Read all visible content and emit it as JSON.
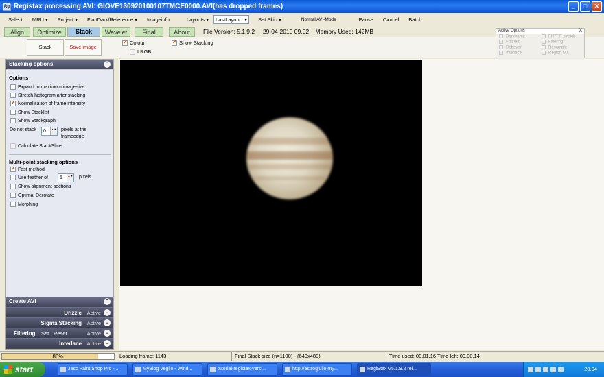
{
  "window": {
    "title": "Registax processing AVI: GIOVE130920100107TMCE0000.AVI(has dropped frames)",
    "icon": "registax-app-icon"
  },
  "menu": {
    "items": [
      "Select",
      "MRU ▾",
      "Project ▾",
      "Flat/Dark/Reference ▾",
      "Imageinfo",
      "Layouts ▾"
    ],
    "layout_value": "LastLayout",
    "items2": [
      "Set Skin ▾"
    ],
    "mode": "Normal AVI-Mode",
    "actions": [
      "Pause",
      "Cancel",
      "Batch"
    ]
  },
  "tabs": [
    "Align",
    "Optimize",
    "Stack",
    "Wavelet",
    "Final",
    "About"
  ],
  "active_tab": "Stack",
  "fileinfo": {
    "version": "File Version: 5.1.9.2",
    "date": "29-04-2010 09.02",
    "memory": "Memory Used: 142MB"
  },
  "toolbar": {
    "stack_label": "Stack",
    "save_label": "Save image",
    "colour": "Colour",
    "lrgb": "LRGB",
    "show_stacking": "Show Stacking"
  },
  "active_options": {
    "title": "Active Options",
    "close": "X",
    "left": [
      "Darkframe",
      "Flatfield",
      "Debayer",
      "Interlace"
    ],
    "right": [
      "FIT/TIF stretch",
      "Filtering",
      "Resample",
      "Region.O.I."
    ]
  },
  "stacking": {
    "header": "Stacking options",
    "options_title": "Options",
    "expand": "Expand to maximum imagesize",
    "stretch": "Stretch histogram after stacking",
    "normalisation": "Normalisation of frame intensity",
    "show_stacklist": "Show Stacklist",
    "show_stackgraph": "Show Stackgraph",
    "do_not_stack": "Do not stack",
    "do_not_stack_value": "0",
    "pixels_at": "pixels at the",
    "frameedge": "frameedge",
    "calc_slice": "Calculate StackSlice",
    "multipoint_title": "Multi-point stacking options",
    "fast_method": "Fast method",
    "feather": "Use feather of",
    "feather_value": "5",
    "pixels": "pixels",
    "show_alignment": "Show alignment sections",
    "optimal_derotate": "Optimal Derotate",
    "morphing": "Morphing"
  },
  "create_avi": {
    "header": "Create AVI",
    "drizzle": "Drizzle",
    "sigma": "Sigma Stacking",
    "filtering": "Filtering",
    "set": "Set",
    "reset": "Reset",
    "interlace": "Interlace",
    "active": "Active"
  },
  "status": {
    "progress_text": "86%",
    "progress": 0.86,
    "loading": "Loading frame: 1143",
    "final_size": "Final Stack size (n=1100) - (640x480)",
    "time": "Time used: 00.01.16 Time left: 00.00.14"
  },
  "taskbar": {
    "start": "start",
    "tasks": [
      "Jasc Paint Shop Pro - ...",
      "MyBlog Veglio - Wind...",
      "tutorial-registax-versi...",
      "http://astrogiulio.my...",
      "RegiStax V5.1.9.2 rel..."
    ],
    "clock": "20.04"
  }
}
